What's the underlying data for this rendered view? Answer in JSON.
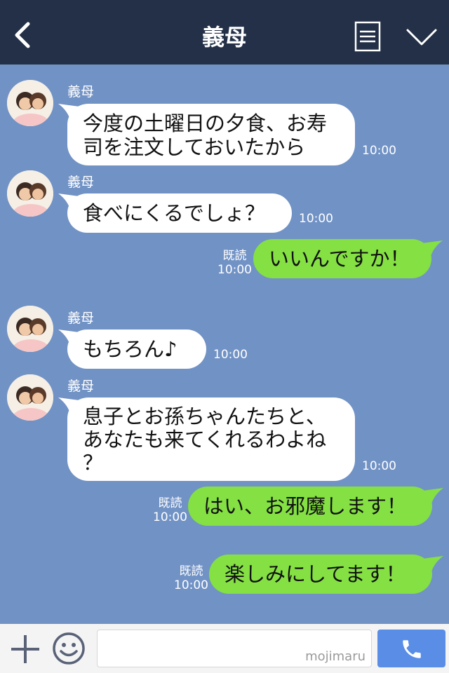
{
  "header": {
    "title": "義母"
  },
  "messages": [
    {
      "sender": "義母",
      "text": "今度の土曜日の夕食、お寿\n司を注文しておいたから",
      "time": "10:00"
    },
    {
      "sender": "義母",
      "text": "食べにくるでしょ？",
      "time": "10:00"
    },
    {
      "text": "いいんですか！",
      "read": "既読",
      "time": "10:00"
    },
    {
      "sender": "義母",
      "text": "もちろん♪",
      "time": "10:00"
    },
    {
      "sender": "義母",
      "text": "息子とお孫ちゃんたちと、\nあなたも来てくれるわよね\n？",
      "time": "10:00"
    },
    {
      "text": "はい、お邪魔します！",
      "read": "既読",
      "time": "10:00"
    },
    {
      "text": "楽しみにしてます！",
      "read": "既読",
      "time": "10:00"
    }
  ],
  "footer": {
    "watermark": "mojimaru"
  },
  "icons": {
    "back": "back-arrow-icon",
    "menu": "menu-icon",
    "chevron": "chevron-down-icon",
    "plus": "plus-icon",
    "emoji": "emoji-icon",
    "call": "phone-icon"
  },
  "colors": {
    "header": "#233047",
    "background": "#7192c5",
    "outgoing": "#84e043",
    "call_button": "#5a8de6"
  }
}
